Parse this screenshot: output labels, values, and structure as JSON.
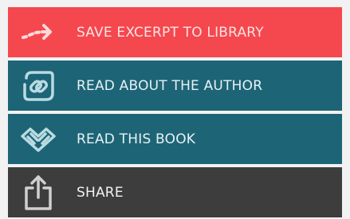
{
  "menu": {
    "items": [
      {
        "id": "save-excerpt",
        "label": "SAVE EXCERPT TO LIBRARY",
        "icon": "dashed-arrow-right-icon",
        "background": "#f4484e",
        "text_color": "#ffe2e2",
        "icon_color": "#ffd9d9"
      },
      {
        "id": "author",
        "label": "READ ABOUT THE AUTHOR",
        "icon": "link-box-icon",
        "background": "#1d6476",
        "text_color": "#e6f2f4",
        "icon_color": "#b9dbe1"
      },
      {
        "id": "read-book",
        "label": "READ THIS BOOK",
        "icon": "open-book-icon",
        "background": "#1d6476",
        "text_color": "#e6f2f4",
        "icon_color": "#b9dbe1"
      },
      {
        "id": "share",
        "label": "SHARE",
        "icon": "share-upload-icon",
        "background": "#3d3d3d",
        "text_color": "#f2f2f2",
        "icon_color": "#d0d0d0"
      }
    ]
  }
}
